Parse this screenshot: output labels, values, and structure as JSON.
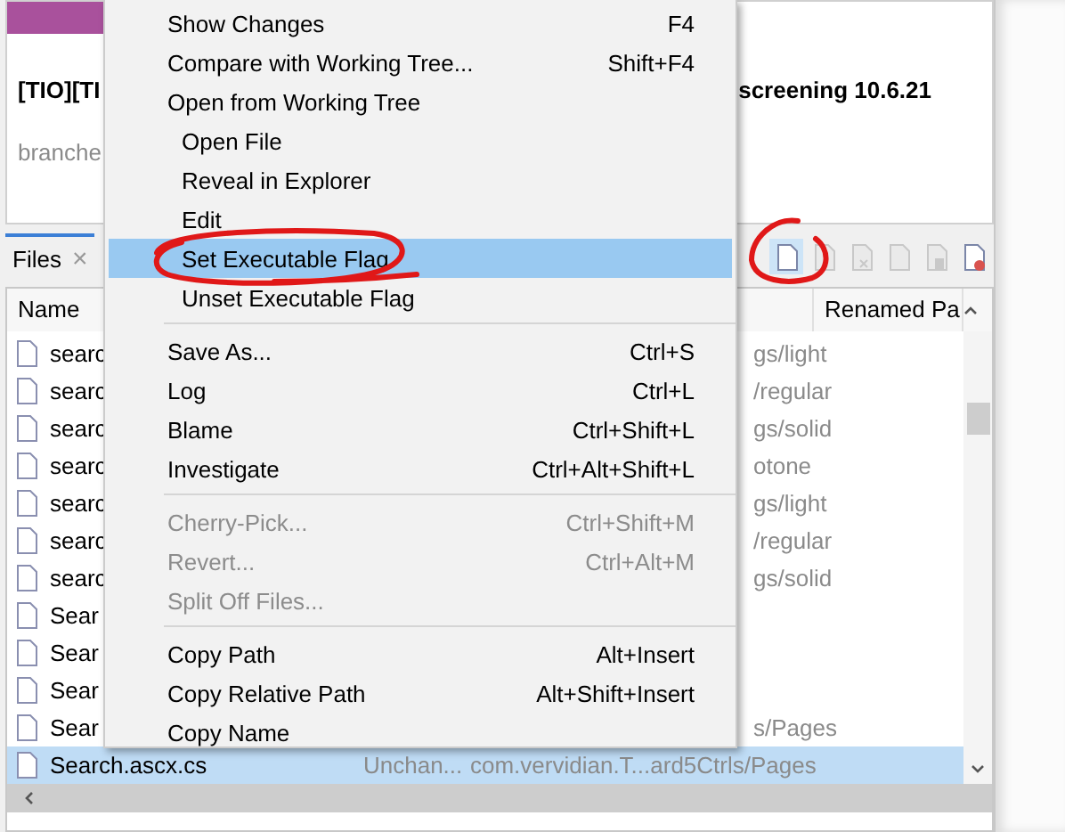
{
  "header": {
    "title_start": "[TIO][TI",
    "title_end": "screening 10.6.21",
    "subtitle": "branche"
  },
  "panel_tab": {
    "label": "Files",
    "close": "×"
  },
  "toolbar": [
    {
      "kind": "file",
      "selected": true,
      "disabled": false
    },
    {
      "kind": "file",
      "selected": false,
      "disabled": true
    },
    {
      "kind": "file-x",
      "selected": false,
      "disabled": true
    },
    {
      "kind": "file",
      "selected": false,
      "disabled": true
    },
    {
      "kind": "file-trash",
      "selected": false,
      "disabled": true
    },
    {
      "kind": "file-remove",
      "selected": false,
      "disabled": false
    }
  ],
  "table": {
    "columns": [
      "Name",
      "Renamed Pa"
    ],
    "rows": [
      {
        "name": "searc",
        "path": "gs/light",
        "selected": false
      },
      {
        "name": "searc",
        "path": "/regular",
        "selected": false
      },
      {
        "name": "searc",
        "path": "gs/solid",
        "selected": false
      },
      {
        "name": "searc",
        "path": "otone",
        "selected": false
      },
      {
        "name": "searc",
        "path": "gs/light",
        "selected": false
      },
      {
        "name": "searc",
        "path": "/regular",
        "selected": false
      },
      {
        "name": "searc",
        "path": "gs/solid",
        "selected": false
      },
      {
        "name": "Sear",
        "selected": false
      },
      {
        "name": "Sear",
        "selected": false
      },
      {
        "name": "Sear",
        "selected": false
      },
      {
        "name": "Sear",
        "path": "s/Pages",
        "selected": false
      },
      {
        "name": "Search.ascx.cs",
        "status": "Unchan...",
        "path": "com.vervidian.T...ard5Ctrls/Pages",
        "selected": true
      }
    ]
  },
  "menu": {
    "items": [
      {
        "kind": "item",
        "label": "Show Changes",
        "shortcut": "F4",
        "disabled": false,
        "selected": false
      },
      {
        "kind": "item",
        "label": "Compare with Working Tree...",
        "shortcut": "Shift+F4",
        "disabled": false,
        "selected": false
      },
      {
        "kind": "item",
        "label": "Open from Working Tree",
        "disabled": false,
        "selected": false,
        "children": [
          {
            "kind": "item",
            "label": "Open File",
            "disabled": false,
            "selected": false
          },
          {
            "kind": "item",
            "label": "Reveal in Explorer",
            "disabled": false,
            "selected": false
          },
          {
            "kind": "item",
            "label": "Edit",
            "disabled": false,
            "selected": false
          },
          {
            "kind": "item",
            "label": "Set Executable Flag",
            "disabled": false,
            "selected": true
          },
          {
            "kind": "item",
            "label": "Unset Executable Flag",
            "disabled": false,
            "selected": false
          }
        ]
      },
      {
        "kind": "separator"
      },
      {
        "kind": "item",
        "label": "Save As...",
        "shortcut": "Ctrl+S",
        "disabled": false,
        "selected": false
      },
      {
        "kind": "item",
        "label": "Log",
        "shortcut": "Ctrl+L",
        "disabled": false,
        "selected": false
      },
      {
        "kind": "item",
        "label": "Blame",
        "shortcut": "Ctrl+Shift+L",
        "disabled": false,
        "selected": false
      },
      {
        "kind": "item",
        "label": "Investigate",
        "shortcut": "Ctrl+Alt+Shift+L",
        "disabled": false,
        "selected": false
      },
      {
        "kind": "separator"
      },
      {
        "kind": "item",
        "label": "Cherry-Pick...",
        "shortcut": "Ctrl+Shift+M",
        "disabled": true,
        "selected": false
      },
      {
        "kind": "item",
        "label": "Revert...",
        "shortcut": "Ctrl+Alt+M",
        "disabled": true,
        "selected": false
      },
      {
        "kind": "item",
        "label": "Split Off Files...",
        "disabled": true,
        "selected": false
      },
      {
        "kind": "separator"
      },
      {
        "kind": "item",
        "label": "Copy Path",
        "shortcut": "Alt+Insert",
        "disabled": false,
        "selected": false
      },
      {
        "kind": "item",
        "label": "Copy Relative Path",
        "shortcut": "Alt+Shift+Insert",
        "disabled": false,
        "selected": false
      },
      {
        "kind": "item",
        "label": "Copy Name",
        "disabled": false,
        "selected": false
      }
    ]
  }
}
